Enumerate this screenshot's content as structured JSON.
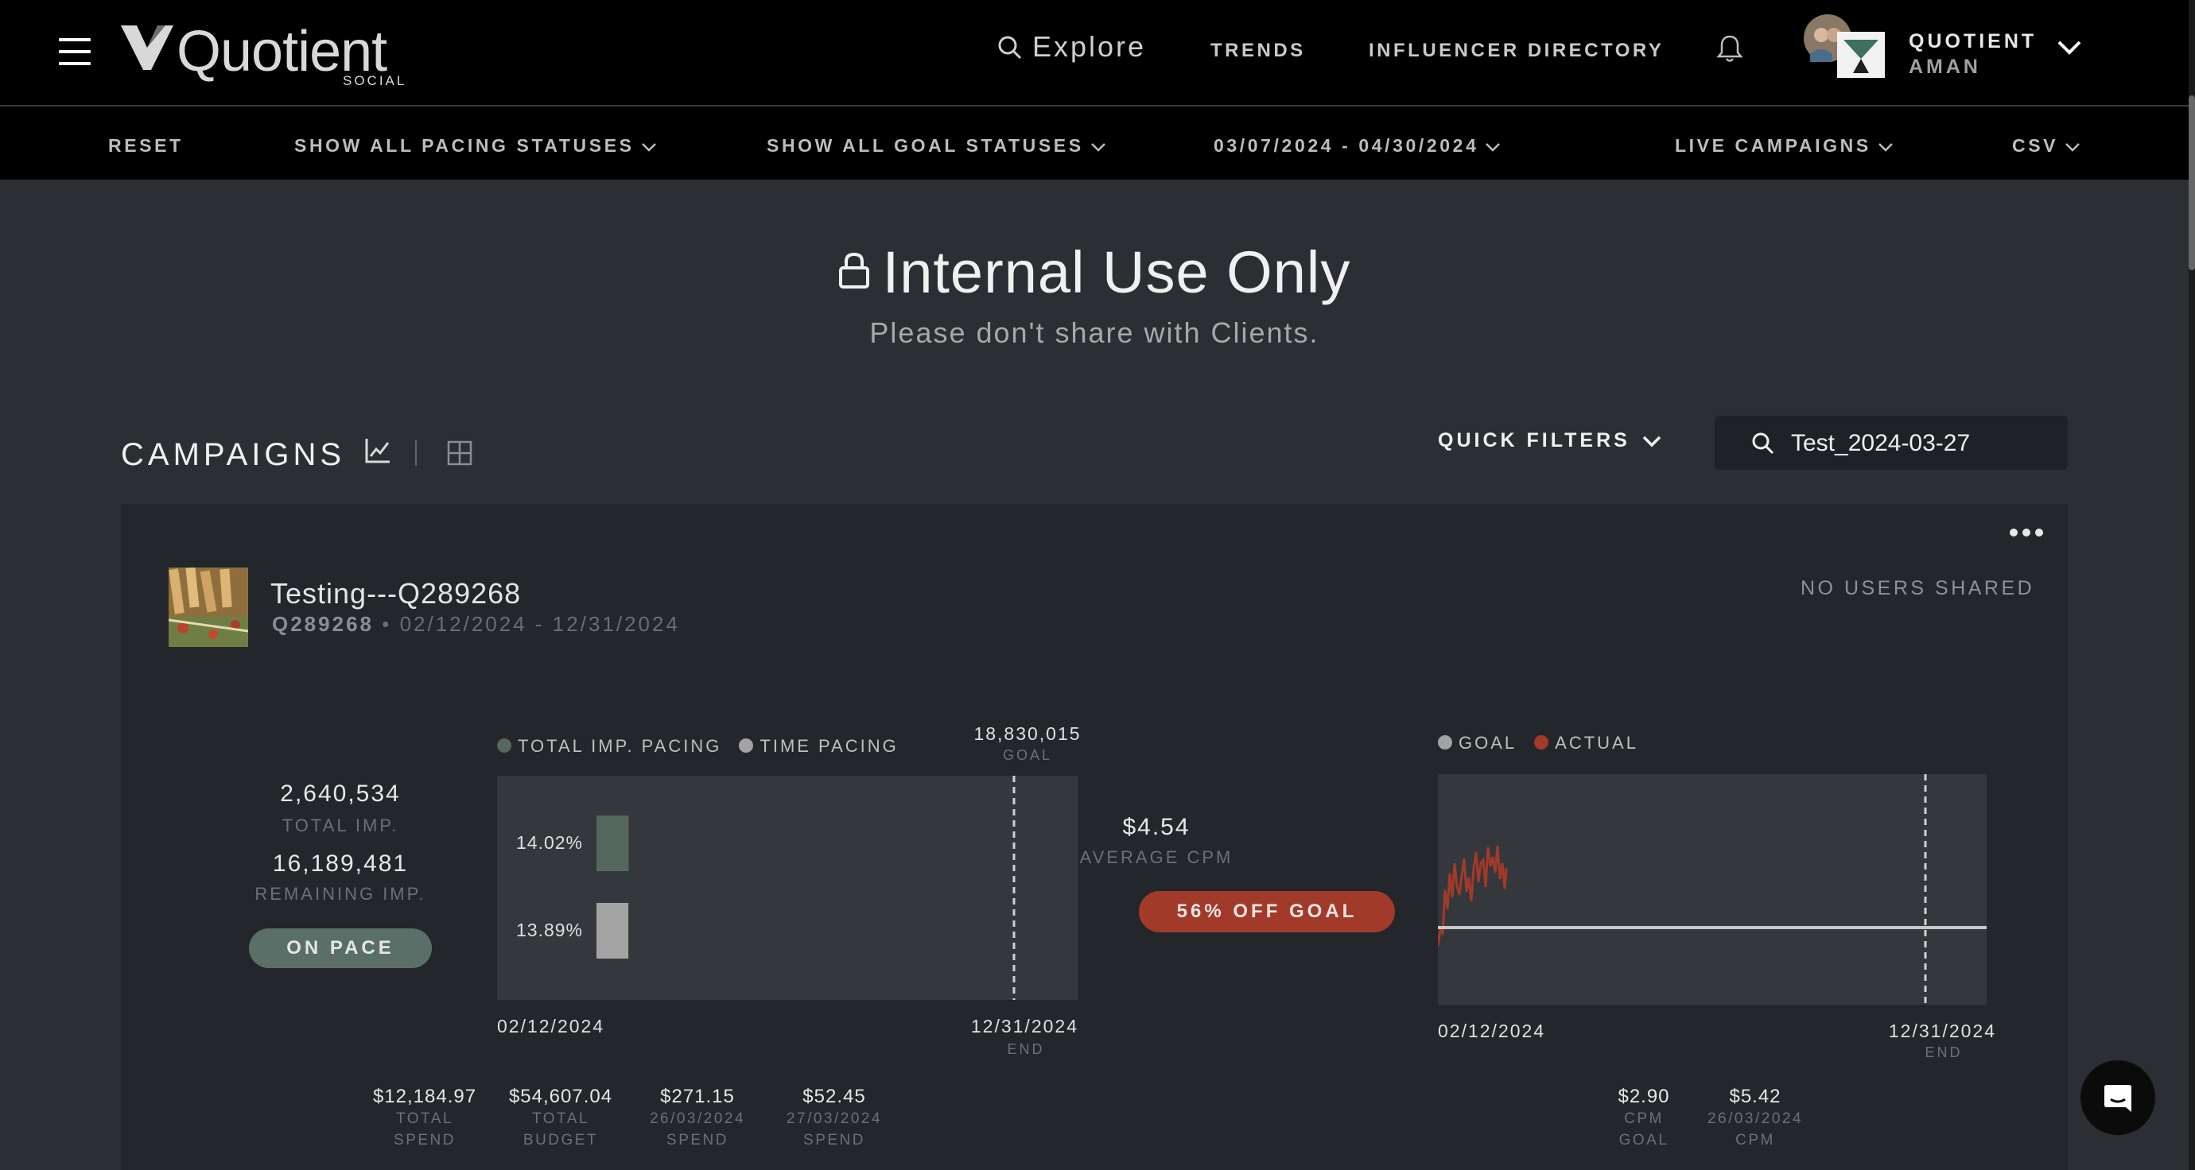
{
  "app": {
    "logo_text": "Quotient",
    "logo_sub": "SOCIAL"
  },
  "nav": {
    "explore": "Explore",
    "trends": "TRENDS",
    "influencer_directory": "INFLUENCER DIRECTORY",
    "user_name": "QUOTIENT",
    "user_sub": "AMAN"
  },
  "filters": {
    "reset": "RESET",
    "pacing": "SHOW ALL PACING STATUSES",
    "goal": "SHOW ALL GOAL STATUSES",
    "date_range": "03/07/2024 - 04/30/2024",
    "live": "LIVE CAMPAIGNS",
    "csv": "CSV"
  },
  "notice": {
    "title": "Internal Use Only",
    "subtitle": "Please don't share with Clients."
  },
  "campaigns": {
    "title": "CAMPAIGNS",
    "quick_filters": "QUICK FILTERS",
    "search_value": "Test_2024-03-27"
  },
  "campaign": {
    "name": "Testing---Q289268",
    "id": "Q289268",
    "separator": "•",
    "dates": "02/12/2024 - 12/31/2024",
    "shared": "NO USERS SHARED",
    "total_imp": "2,640,534",
    "total_imp_label": "TOTAL IMP.",
    "remaining_imp": "16,189,481",
    "remaining_imp_label": "REMAINING IMP.",
    "status": "ON PACE",
    "pacing_legend": {
      "total": "TOTAL IMP. PACING",
      "time": "TIME PACING"
    },
    "goal_value": "18,830,015",
    "goal_label": "GOAL",
    "pacing_bars": [
      {
        "label": "14.02%",
        "value": 14.02,
        "color": "#55675f"
      },
      {
        "label": "13.89%",
        "value": 13.89,
        "color": "#a3a3a3"
      }
    ],
    "start_date": "02/12/2024",
    "end_date": "12/31/2024",
    "end_label": "END",
    "avg_cpm": "$4.54",
    "avg_cpm_label": "AVERAGE CPM",
    "goal_status": "56% OFF GOAL",
    "cpm_legend": {
      "goal": "GOAL",
      "actual": "ACTUAL"
    },
    "colors": {
      "goal": "#a3a3a3",
      "actual": "#a23a2a",
      "pacing_total": "#55675f"
    },
    "financials": [
      {
        "value": "$12,184.97",
        "label1": "TOTAL",
        "label2": "SPEND"
      },
      {
        "value": "$54,607.04",
        "label1": "TOTAL",
        "label2": "BUDGET"
      },
      {
        "value": "$271.15",
        "label1": "26/03/2024",
        "label2": "SPEND"
      },
      {
        "value": "$52.45",
        "label1": "27/03/2024",
        "label2": "SPEND"
      }
    ],
    "cpm_stats": [
      {
        "value": "$2.90",
        "label1": "CPM",
        "label2": "GOAL"
      },
      {
        "value": "$5.42",
        "label1": "26/03/2024",
        "label2": "CPM"
      }
    ]
  },
  "icons": {
    "menu": "hamburger-icon",
    "search": "search-icon",
    "bell": "bell-icon",
    "chevron": "chevron-down-icon",
    "lock": "lock-icon",
    "line_chart": "line-chart-icon",
    "grid": "grid-icon",
    "more": "more-dots-icon",
    "chat": "chat-icon"
  }
}
